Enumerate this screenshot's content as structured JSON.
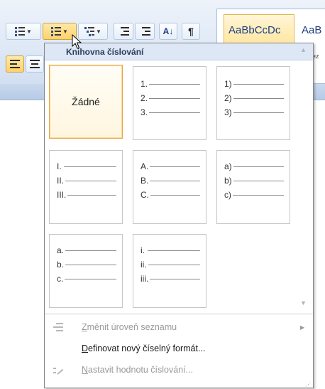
{
  "ribbon": {
    "styles": {
      "selected_sample": "AaBbCcDc",
      "next_sample": "AaB",
      "next_sub": "ez"
    },
    "icons": {
      "bullets": "bullet-list-icon",
      "numbering": "numbered-list-icon",
      "multilevel": "multilevel-list-icon",
      "decrease_indent": "decrease-indent-icon",
      "increase_indent": "increase-indent-icon",
      "sort": "sort-icon",
      "show_marks": "pilcrow-icon"
    },
    "sort_glyph": "A↓",
    "pilcrow": "¶"
  },
  "dropdown": {
    "header": "Knihovna číslování",
    "tiles": [
      {
        "type": "none",
        "label": "Žádné"
      },
      {
        "type": "list",
        "lines": [
          "1.",
          "2.",
          "3."
        ]
      },
      {
        "type": "list",
        "lines": [
          "1)",
          "2)",
          "3)"
        ]
      },
      {
        "type": "list",
        "lines": [
          "I.",
          "II.",
          "III."
        ]
      },
      {
        "type": "list",
        "lines": [
          "A.",
          "B.",
          "C."
        ]
      },
      {
        "type": "list",
        "lines": [
          "a)",
          "b)",
          "c)"
        ]
      },
      {
        "type": "list",
        "lines": [
          "a.",
          "b.",
          "c."
        ]
      },
      {
        "type": "list",
        "lines": [
          "i.",
          "ii.",
          "iii."
        ]
      }
    ],
    "menu": [
      {
        "label_ul": "Z",
        "label_rest": "měnit úroveň seznamu",
        "enabled": false,
        "submenu": true,
        "icon": "change-list-level-icon"
      },
      {
        "label_ul": "D",
        "label_rest": "efinovat nový číselný formát...",
        "enabled": true,
        "submenu": false,
        "icon": ""
      },
      {
        "label_ul": "N",
        "label_rest": "astavit hodnotu číslování...",
        "enabled": false,
        "submenu": false,
        "icon": "set-numbering-value-icon"
      }
    ]
  },
  "colors": {
    "accent_selected_border": "#e3a54b",
    "header_bg": "#dde7f5",
    "ribbon_bg": "#dce7f5"
  }
}
